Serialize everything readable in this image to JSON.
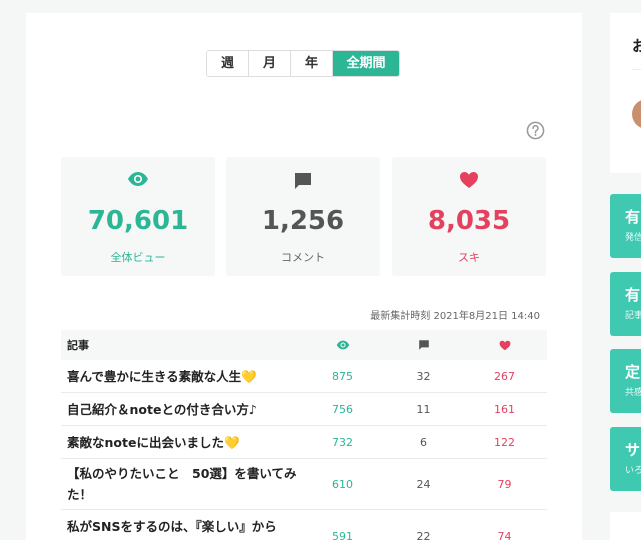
{
  "period_tabs": [
    {
      "label": "週"
    },
    {
      "label": "月"
    },
    {
      "label": "年"
    },
    {
      "label": "全期間"
    }
  ],
  "stats": {
    "views": {
      "value": "70,601",
      "label": "全体ビュー",
      "icon": "eye-icon"
    },
    "comments": {
      "value": "1,256",
      "label": "コメント",
      "icon": "comment-icon"
    },
    "likes": {
      "value": "8,035",
      "label": "スキ",
      "icon": "heart-icon"
    }
  },
  "timestamp": "最新集計時刻 2021年8月21日 14:40",
  "table": {
    "header_title": "記事",
    "rows": [
      {
        "title": "喜んで豊かに生きる素敵な人生💛",
        "views": "875",
        "comments": "32",
        "likes": "267"
      },
      {
        "title": "自己紹介＆noteとの付き合い方♪",
        "views": "756",
        "comments": "11",
        "likes": "161"
      },
      {
        "title": "素敵なnoteに出会いました💛",
        "views": "732",
        "comments": "6",
        "likes": "122"
      },
      {
        "title": "【私のやりたいこと　50選】を書いてみた！",
        "views": "610",
        "comments": "24",
        "likes": "79"
      },
      {
        "title": "私がSNSをするのは、『楽しい』から",
        "views": "591",
        "comments": "22",
        "likes": "74"
      }
    ]
  },
  "sidebar": {
    "card_heading": "お",
    "buttons": [
      {
        "title": "有",
        "sub": "発信"
      },
      {
        "title": "有",
        "sub": "記事"
      },
      {
        "title": "定",
        "sub": "共感"
      },
      {
        "title": "サ",
        "sub": "いろ"
      }
    ]
  },
  "colors": {
    "accent": "#2cb696",
    "like": "#e5405e",
    "comment": "#555555",
    "sidebar_button": "#3ec9b0"
  }
}
